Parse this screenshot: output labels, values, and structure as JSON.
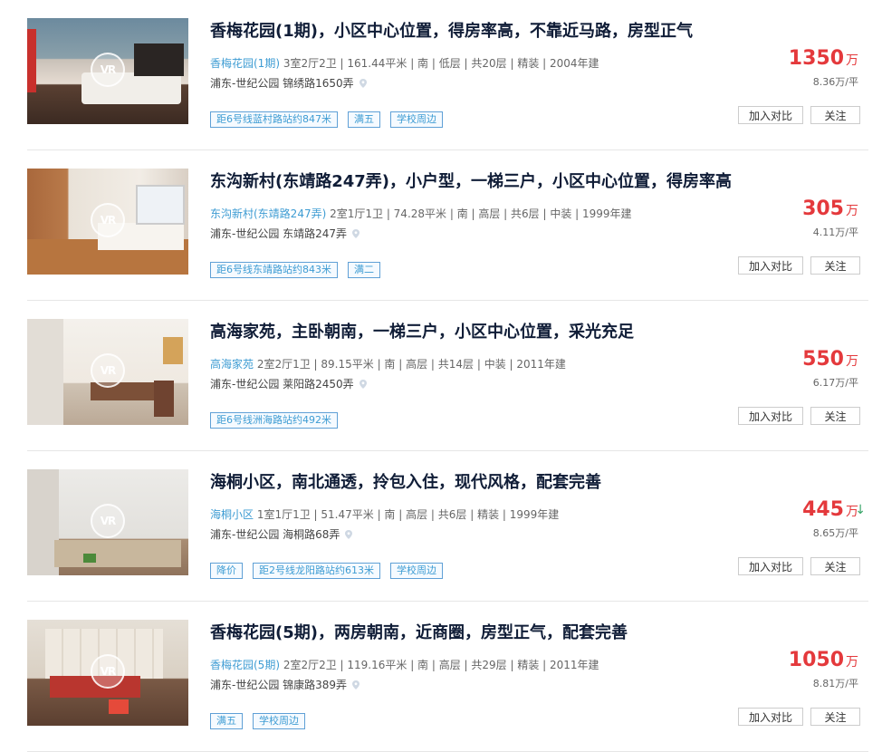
{
  "listings": [
    {
      "title": "香梅花园(1期)，小区中心位置，得房率高，不靠近马路，房型正气",
      "community": "香梅花园(1期)",
      "info": " 3室2厅2卫 | 161.44平米 | 南 | 低层 | 共20层 | 精装 | 2004年建",
      "location": "浦东-世纪公园 锦绣路1650弄",
      "tags": [
        "距6号线蓝村路站约847米",
        "满五",
        "学校周边"
      ],
      "price": "1350",
      "price_unit": "万",
      "unit_price": "8.36万/平",
      "price_down": false,
      "vr_label": "VR",
      "compare_label": "加入对比",
      "follow_label": "关注"
    },
    {
      "title": "东沟新村(东靖路247弄)，小户型，一梯三户，小区中心位置，得房率高",
      "community": "东沟新村(东靖路247弄)",
      "info": " 2室1厅1卫 | 74.28平米 | 南 | 高层 | 共6层 | 中装 | 1999年建",
      "location": "浦东-世纪公园 东靖路247弄",
      "tags": [
        "距6号线东靖路站约843米",
        "满二"
      ],
      "price": "305",
      "price_unit": "万",
      "unit_price": "4.11万/平",
      "price_down": false,
      "vr_label": "VR",
      "compare_label": "加入对比",
      "follow_label": "关注"
    },
    {
      "title": "高海家苑，主卧朝南，一梯三户，小区中心位置，采光充足",
      "community": "高海家苑",
      "info": " 2室2厅1卫 | 89.15平米 | 南 | 高层 | 共14层 | 中装 | 2011年建",
      "location": "浦东-世纪公园 莱阳路2450弄",
      "tags": [
        "距6号线洲海路站约492米"
      ],
      "price": "550",
      "price_unit": "万",
      "unit_price": "6.17万/平",
      "price_down": false,
      "vr_label": "VR",
      "compare_label": "加入对比",
      "follow_label": "关注"
    },
    {
      "title": "海桐小区，南北通透，拎包入住，现代风格，配套完善",
      "community": "海桐小区",
      "info": " 1室1厅1卫 | 51.47平米 | 南 | 高层 | 共6层 | 精装 | 1999年建",
      "location": "浦东-世纪公园 海桐路68弄",
      "tags": [
        "降价",
        "距2号线龙阳路站约613米",
        "学校周边"
      ],
      "price": "445",
      "price_unit": "万",
      "unit_price": "8.65万/平",
      "price_down": true,
      "down_arrow": "↓",
      "vr_label": "VR",
      "compare_label": "加入对比",
      "follow_label": "关注"
    },
    {
      "title": "香梅花园(5期)，两房朝南，近商圈，房型正气，配套完善",
      "community": "香梅花园(5期)",
      "info": " 2室2厅2卫 | 119.16平米 | 南 | 高层 | 共29层 | 精装 | 2011年建",
      "location": "浦东-世纪公园 锦康路389弄",
      "tags": [
        "满五",
        "学校周边"
      ],
      "price": "1050",
      "price_unit": "万",
      "unit_price": "8.81万/平",
      "price_down": false,
      "vr_label": "VR",
      "compare_label": "加入对比",
      "follow_label": "关注"
    }
  ],
  "colors": {
    "price": "#e4393c",
    "community_link": "#3e9cd3",
    "tag_border": "#5fa0d6",
    "price_down_arrow": "#3aa56a"
  },
  "icons": {
    "vr": "vr-badge-icon",
    "location": "location-pin-icon",
    "price_down": "arrow-down-icon"
  }
}
